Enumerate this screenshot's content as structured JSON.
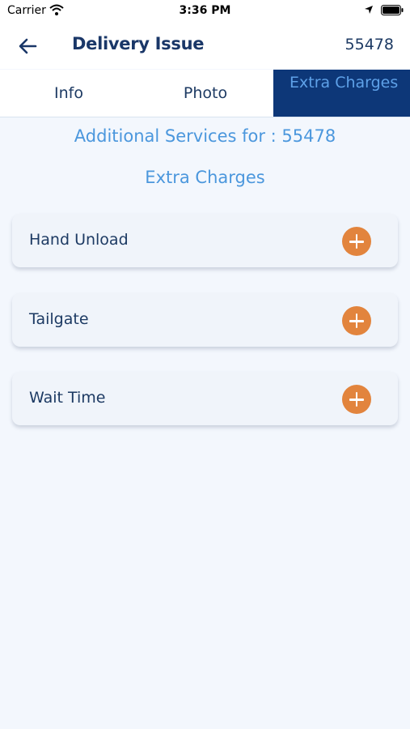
{
  "status_bar": {
    "carrier": "Carrier",
    "time": "3:36 PM"
  },
  "nav": {
    "title": "Delivery Issue",
    "order_number": "55478"
  },
  "tabs": [
    {
      "label": "Info",
      "active": false
    },
    {
      "label": "Photo",
      "active": false
    },
    {
      "label": "Extra Charges",
      "active": true
    }
  ],
  "content": {
    "title": "Additional Services for : 55478",
    "subtitle": "Extra Charges",
    "items": [
      {
        "label": "Hand Unload"
      },
      {
        "label": "Tailgate"
      },
      {
        "label": "Wait Time"
      }
    ]
  },
  "colors": {
    "accent": "#4b97dd",
    "active_tab": "#0d3778",
    "add_button": "#e2843d",
    "title_text": "#1a3768"
  }
}
